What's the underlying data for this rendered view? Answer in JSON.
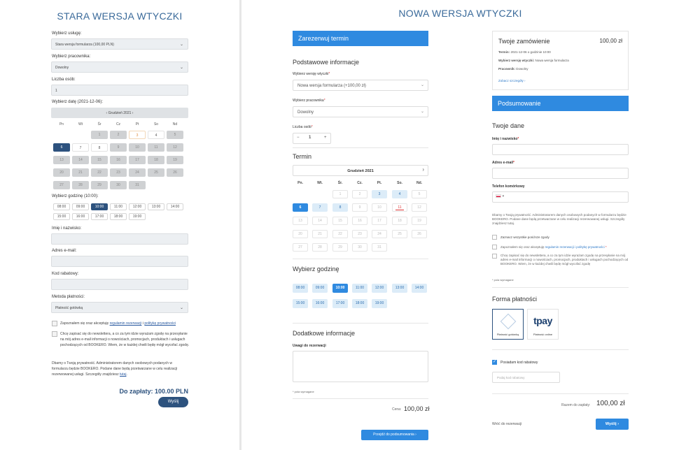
{
  "old": {
    "title": "STARA WERSJA WTYCZKI",
    "service_label": "Wybierz usługę:",
    "service_value": "Stara wersja formularza (100,00 PLN)",
    "staff_label": "Wybierz pracownika:",
    "staff_value": "Dowolny",
    "persons_label": "Liczba osób:",
    "persons_value": "1",
    "date_label": "Wybierz datę (2021-12-06):",
    "month": "Grudzień 2021",
    "prev": "‹",
    "next": "›",
    "weekdays": [
      "Pn",
      "Wt",
      "Śr",
      "Cz",
      "Pt",
      "So",
      "Nd"
    ],
    "days": [
      "1",
      "2",
      "3",
      "4",
      "5",
      "6",
      "7",
      "8",
      "9",
      "10",
      "11",
      "12",
      "13",
      "14",
      "15",
      "16",
      "17",
      "18",
      "19",
      "20",
      "21",
      "22",
      "23",
      "24",
      "25",
      "26",
      "27",
      "28",
      "29",
      "30",
      "31"
    ],
    "time_label": "Wybierz godzinę (10:00):",
    "times": [
      "08:00",
      "09:00",
      "10:00",
      "11:00",
      "12:00",
      "13:00",
      "14:00",
      "15:00",
      "16:00",
      "17:00",
      "18:00",
      "19:00"
    ],
    "name_label": "Imię i nazwisko:",
    "email_label": "Adres e-mail:",
    "code_label": "Kod rabatowy:",
    "pay_label": "Metoda płatności:",
    "pay_value": "Płatność gotówką",
    "terms_pre": "Zapoznałem się oraz akceptuję ",
    "terms_link1": "regulamin rezerwacji",
    "terms_mid": " i ",
    "terms_link2": "politykę prywatności",
    "news_text": "Chcę zapisać się do newslettera, a co za tym idzie wyrażam zgodę na przesyłanie na mój adres e-mail informacji o nowościach, promocjach, produktach i usługach pochodzących od BOOKERO. Wiem, że w każdej chwili będę mógł wycofać zgodę.",
    "privacy_text": "Dbamy o Twoją prywatność. Administratorem danych osobowych podanych w formularzu będzie BOOKERO. Podane dane będą przetwarzane w celu realizacji rezerwowanej usługi. Szczegóły znajdziesz ",
    "privacy_link": "tutaj",
    "total": "Do zapłaty: 100.00 PLN",
    "submit": "Wyślij"
  },
  "new": {
    "title": "NOWA WERSJA WTYCZKI",
    "reserve": "Zarezerwuj termin",
    "basic_h": "Podstawowe informacje",
    "version_label": "Wybierz wersję wtyczki",
    "version_value": "Nowa wersja formularza (+100,00 zł)",
    "staff_label": "Wybierz pracownika",
    "staff_value": "Dowolny",
    "persons_label": "Liczba osób",
    "persons_value": "1",
    "minus": "−",
    "plus": "+",
    "term_h": "Termin",
    "month": "Grudzień 2021",
    "next": "›",
    "weekdays": [
      "Pn.",
      "Wt.",
      "Śr.",
      "Cz.",
      "Pt.",
      "So.",
      "Nd."
    ],
    "days": [
      "1",
      "2",
      "3",
      "4",
      "5",
      "6",
      "7",
      "8",
      "9",
      "10",
      "11",
      "12",
      "13",
      "14",
      "15",
      "16",
      "17",
      "18",
      "19",
      "20",
      "21",
      "22",
      "23",
      "24",
      "25",
      "26",
      "27",
      "28",
      "29",
      "30",
      "31"
    ],
    "hour_h": "Wybierz godzinę",
    "times": [
      "08:00",
      "09:00",
      "10:00",
      "11:00",
      "12:00",
      "13:00",
      "14:00",
      "15:00",
      "16:00",
      "17:00",
      "18:00",
      "19:00"
    ],
    "extra_h": "Dodatkowe informacje",
    "notes_label": "Uwagi do rezerwacji",
    "required_note": "* pola wymagane",
    "price_label": "Cena:",
    "price_value": "100,00 zł",
    "next_btn": "Przejdź do podsumowania",
    "order_h": "Twoje zamówienie",
    "order_price": "100,00 zł",
    "term_line_k": "Termin:",
    "term_line_v": "2021-12-06 o godzinie 10:00",
    "version_line_k": "Wybierz wersję wtyczki:",
    "version_line_v": "Nowa wersja formularza",
    "staff_line_k": "Pracownik:",
    "staff_line_v": "Dowolny",
    "details_link": "Zobacz szczegóły",
    "summary": "Podsumowanie",
    "your_data": "Twoje dane",
    "name_label": "Imię i nazwisko",
    "email_label": "Adres e-mail",
    "phone_label": "Telefon komórkowy",
    "phone_prefix": "▾",
    "privacy": "Dbamy o Twoją prywatność. Administratorem danych osobowych podanych w formularzu będzie BOOKERO. Podane dane będą przetwarzane w celu realizacji rezerwowanej usługi. Szczegóły znajdziesz tutaj.",
    "check_all": "Zaznacz wszystkie poniższe zgody",
    "terms_pre": "Zapoznałem się oraz akceptuję ",
    "terms_link": "regulamin rezerwacji i politykę prywatności",
    "news": "Chcę zapisać się do newslettera, a co za tym idzie wyrażam zgodę na przesyłanie na mój adres e-mail informacji o nowościach, promocjach, produktach i usługach pochodzących od BOOKERO. Wiem, że w każdej chwili będę mógł wycofać zgodę",
    "required_note2": "* pola wymagane",
    "payment_h": "Forma płatności",
    "pay_cash": "Płatność gotówką",
    "pay_online": "Płatność online",
    "tpay": "tpay",
    "have_code": "Posiadam kod rabatowy",
    "code_placeholder": "Podaj kod rabatowy",
    "total_label": "Razem do zapłaty:",
    "total_value": "100,00 zł",
    "back": "Wróć do rezerwacji",
    "send": "Wyślij"
  }
}
